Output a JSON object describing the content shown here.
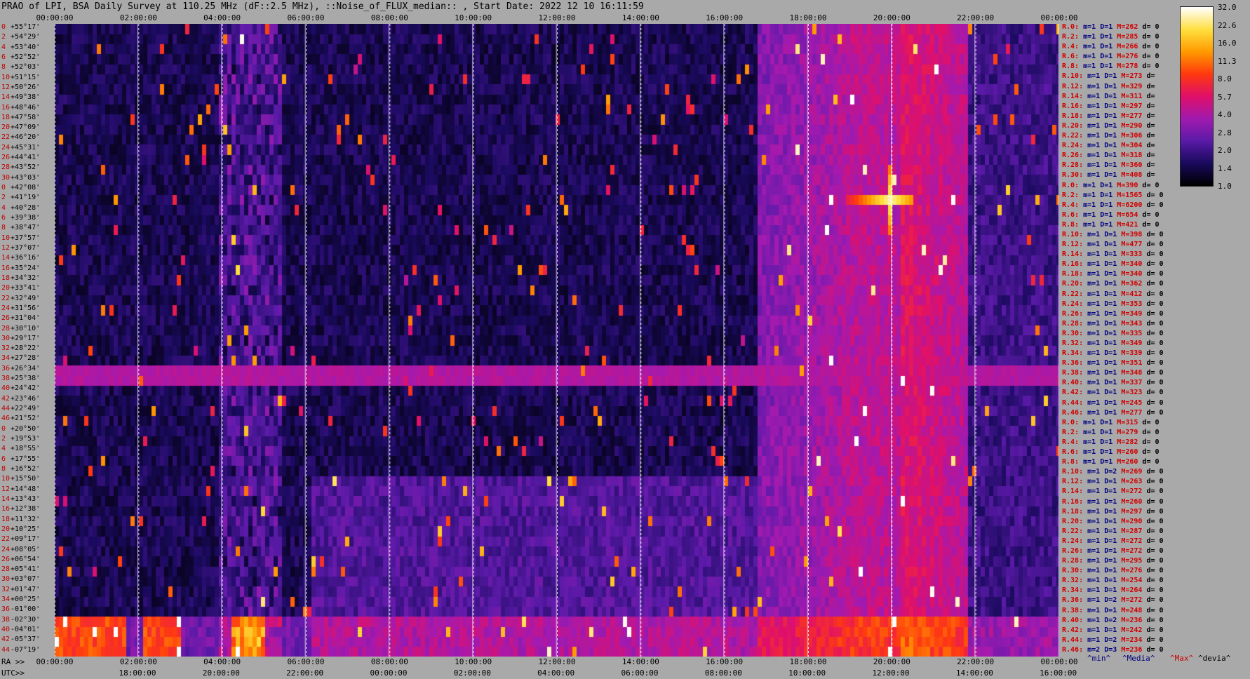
{
  "title": "PRAO of LPI, BSA Daily Survey at 110.25 MHz (dF::2.5 MHz), ::Noise_of_FLUX_median:: , Start Date: 2022 12 10 16:11:59",
  "chart_data": {
    "type": "heatmap",
    "top_axis_ticks": [
      "00:00:00",
      "02:00:00",
      "04:00:00",
      "06:00:00",
      "08:00:00",
      "10:00:00",
      "12:00:00",
      "14:00:00",
      "16:00:00",
      "18:00:00",
      "20:00:00",
      "22:00:00",
      "00:00:00"
    ],
    "ra_axis_label": "RA >>",
    "ra_axis_ticks": [
      "00:00:00",
      "02:00:00",
      "04:00:00",
      "06:00:00",
      "08:00:00",
      "10:00:00",
      "12:00:00",
      "14:00:00",
      "16:00:00",
      "18:00:00",
      "20:00:00",
      "22:00:00",
      "00:00:00"
    ],
    "utc_axis_label": "UTC>>",
    "utc_axis_ticks": [
      "18:00:00",
      "20:00:00",
      "22:00:00",
      "00:00:00",
      "02:00:00",
      "04:00:00",
      "06:00:00",
      "08:00:00",
      "10:00:00",
      "12:00:00",
      "14:00:00",
      "16:00:00"
    ],
    "declinations": [
      "+55°17'",
      "+54°29'",
      "+53°40'",
      "+52°52'",
      "+52°03'",
      "+51°15'",
      "+50°26'",
      "+49°38'",
      "+48°46'",
      "+47°58'",
      "+47°09'",
      "+46°20'",
      "+45°31'",
      "+44°41'",
      "+43°52'",
      "+43°03'",
      "+42°08'",
      "+41°19'",
      "+40°28'",
      "+39°38'",
      "+38°47'",
      "+37°57'",
      "+37°07'",
      "+36°16'",
      "+35°24'",
      "+34°32'",
      "+33°41'",
      "+32°49'",
      "+31°56'",
      "+31°04'",
      "+30°10'",
      "+29°17'",
      "+28°22'",
      "+27°28'",
      "+26°34'",
      "+25°38'",
      "+24°42'",
      "+23°46'",
      "+22°49'",
      "+21°52'",
      "+20°50'",
      "+19°53'",
      "+18°55'",
      "+17°55'",
      "+16°52'",
      "+15°50'",
      "+14°48'",
      "+13°43'",
      "+12°38'",
      "+11°32'",
      "+10°25'",
      "+09°17'",
      "+08°05'",
      "+06°54'",
      "+05°41'",
      "+03°07'",
      "+01°47'",
      "+00°25'",
      "-01°00'",
      "-02°30'",
      "-04°01'",
      "-05°37'",
      "-07°19'"
    ],
    "row_indices": [
      "0",
      "2",
      "4",
      "6",
      "8",
      "10",
      "12",
      "14",
      "16",
      "18",
      "20",
      "22",
      "24",
      "26",
      "28",
      "30",
      "0",
      "2",
      "4",
      "6",
      "8",
      "10",
      "12",
      "14",
      "16",
      "18",
      "20",
      "22",
      "24",
      "26",
      "28",
      "30",
      "32",
      "34",
      "36",
      "38",
      "40",
      "42",
      "44",
      "46",
      "0",
      "2",
      "4",
      "6",
      "8",
      "10",
      "12",
      "14",
      "16",
      "18",
      "20",
      "22",
      "24",
      "26",
      "28",
      "30",
      "32",
      "34",
      "36",
      "38",
      "40",
      "42",
      "44"
    ],
    "beam_stats": [
      {
        "r": "R.0:",
        "m": "m=1",
        "d": "D=1",
        "mx": "M=262",
        "dv": "d= 0"
      },
      {
        "r": "R.2:",
        "m": "m=1",
        "d": "D=1",
        "mx": "M=285",
        "dv": "d= 0"
      },
      {
        "r": "R.4:",
        "m": "m=1",
        "d": "D=1",
        "mx": "M=266",
        "dv": "d= 0"
      },
      {
        "r": "R.6:",
        "m": "m=1",
        "d": "D=1",
        "mx": "M=276",
        "dv": "d= 0"
      },
      {
        "r": "R.8:",
        "m": "m=1",
        "d": "D=1",
        "mx": "M=278",
        "dv": "d= 0"
      },
      {
        "r": "R.10:",
        "m": "m=1",
        "d": "D=1",
        "mx": "M=273",
        "dv": "d="
      },
      {
        "r": "R.12:",
        "m": "m=1",
        "d": "D=1",
        "mx": "M=329",
        "dv": "d="
      },
      {
        "r": "R.14:",
        "m": "m=1",
        "d": "D=1",
        "mx": "M=311",
        "dv": "d="
      },
      {
        "r": "R.16:",
        "m": "m=1",
        "d": "D=1",
        "mx": "M=297",
        "dv": "d="
      },
      {
        "r": "R.18:",
        "m": "m=1",
        "d": "D=1",
        "mx": "M=277",
        "dv": "d="
      },
      {
        "r": "R.20:",
        "m": "m=1",
        "d": "D=1",
        "mx": "M=290",
        "dv": "d="
      },
      {
        "r": "R.22:",
        "m": "m=1",
        "d": "D=1",
        "mx": "M=306",
        "dv": "d="
      },
      {
        "r": "R.24:",
        "m": "m=1",
        "d": "D=1",
        "mx": "M=304",
        "dv": "d="
      },
      {
        "r": "R.26:",
        "m": "m=1",
        "d": "D=1",
        "mx": "M=318",
        "dv": "d="
      },
      {
        "r": "R.28:",
        "m": "m=1",
        "d": "D=1",
        "mx": "M=360",
        "dv": "d="
      },
      {
        "r": "R.30:",
        "m": "m=1",
        "d": "D=1",
        "mx": "M=408",
        "dv": "d="
      },
      {
        "r": "R.0:",
        "m": "m=1",
        "d": "D=1",
        "mx": "M=390",
        "dv": "d= 0"
      },
      {
        "r": "R.2:",
        "m": "m=1",
        "d": "D=1",
        "mx": "M=1565",
        "dv": "d= 0"
      },
      {
        "r": "R.4:",
        "m": "m=1",
        "d": "D=1",
        "mx": "M=6200",
        "dv": "d= 0"
      },
      {
        "r": "R.6:",
        "m": "m=1",
        "d": "D=1",
        "mx": "M=654",
        "dv": "d= 0"
      },
      {
        "r": "R.8:",
        "m": "m=1",
        "d": "D=1",
        "mx": "M=421",
        "dv": "d= 0"
      },
      {
        "r": "R.10:",
        "m": "m=1",
        "d": "D=1",
        "mx": "M=398",
        "dv": "d= 0"
      },
      {
        "r": "R.12:",
        "m": "m=1",
        "d": "D=1",
        "mx": "M=477",
        "dv": "d= 0"
      },
      {
        "r": "R.14:",
        "m": "m=1",
        "d": "D=1",
        "mx": "M=333",
        "dv": "d= 0"
      },
      {
        "r": "R.16:",
        "m": "m=1",
        "d": "D=1",
        "mx": "M=340",
        "dv": "d= 0"
      },
      {
        "r": "R.18:",
        "m": "m=1",
        "d": "D=1",
        "mx": "M=340",
        "dv": "d= 0"
      },
      {
        "r": "R.20:",
        "m": "m=1",
        "d": "D=1",
        "mx": "M=362",
        "dv": "d= 0"
      },
      {
        "r": "R.22:",
        "m": "m=1",
        "d": "D=1",
        "mx": "M=412",
        "dv": "d= 0"
      },
      {
        "r": "R.24:",
        "m": "m=1",
        "d": "D=1",
        "mx": "M=353",
        "dv": "d= 0"
      },
      {
        "r": "R.26:",
        "m": "m=1",
        "d": "D=1",
        "mx": "M=349",
        "dv": "d= 0"
      },
      {
        "r": "R.28:",
        "m": "m=1",
        "d": "D=1",
        "mx": "M=343",
        "dv": "d= 0"
      },
      {
        "r": "R.30:",
        "m": "m=1",
        "d": "D=1",
        "mx": "M=335",
        "dv": "d= 0"
      },
      {
        "r": "R.32:",
        "m": "m=1",
        "d": "D=1",
        "mx": "M=349",
        "dv": "d= 0"
      },
      {
        "r": "R.34:",
        "m": "m=1",
        "d": "D=1",
        "mx": "M=339",
        "dv": "d= 0"
      },
      {
        "r": "R.36:",
        "m": "m=1",
        "d": "D=1",
        "mx": "M=351",
        "dv": "d= 0"
      },
      {
        "r": "R.38:",
        "m": "m=1",
        "d": "D=1",
        "mx": "M=348",
        "dv": "d= 0"
      },
      {
        "r": "R.40:",
        "m": "m=1",
        "d": "D=1",
        "mx": "M=337",
        "dv": "d= 0"
      },
      {
        "r": "R.42:",
        "m": "m=1",
        "d": "D=1",
        "mx": "M=323",
        "dv": "d= 0"
      },
      {
        "r": "R.44:",
        "m": "m=1",
        "d": "D=1",
        "mx": "M=245",
        "dv": "d= 0"
      },
      {
        "r": "R.46:",
        "m": "m=1",
        "d": "D=1",
        "mx": "M=277",
        "dv": "d= 0"
      },
      {
        "r": "R.0:",
        "m": "m=1",
        "d": "D=1",
        "mx": "M=315",
        "dv": "d= 0"
      },
      {
        "r": "R.2:",
        "m": "m=1",
        "d": "D=1",
        "mx": "M=279",
        "dv": "d= 0"
      },
      {
        "r": "R.4:",
        "m": "m=1",
        "d": "D=1",
        "mx": "M=282",
        "dv": "d= 0"
      },
      {
        "r": "R.6:",
        "m": "m=1",
        "d": "D=1",
        "mx": "M=260",
        "dv": "d= 0"
      },
      {
        "r": "R.8:",
        "m": "m=1",
        "d": "D=1",
        "mx": "M=260",
        "dv": "d= 0"
      },
      {
        "r": "R.10:",
        "m": "m=1",
        "d": "D=2",
        "mx": "M=269",
        "dv": "d= 0"
      },
      {
        "r": "R.12:",
        "m": "m=1",
        "d": "D=1",
        "mx": "M=263",
        "dv": "d= 0"
      },
      {
        "r": "R.14:",
        "m": "m=1",
        "d": "D=1",
        "mx": "M=272",
        "dv": "d= 0"
      },
      {
        "r": "R.16:",
        "m": "m=1",
        "d": "D=1",
        "mx": "M=260",
        "dv": "d= 0"
      },
      {
        "r": "R.18:",
        "m": "m=1",
        "d": "D=1",
        "mx": "M=297",
        "dv": "d= 0"
      },
      {
        "r": "R.20:",
        "m": "m=1",
        "d": "D=1",
        "mx": "M=290",
        "dv": "d= 0"
      },
      {
        "r": "R.22:",
        "m": "m=1",
        "d": "D=1",
        "mx": "M=287",
        "dv": "d= 0"
      },
      {
        "r": "R.24:",
        "m": "m=1",
        "d": "D=1",
        "mx": "M=272",
        "dv": "d= 0"
      },
      {
        "r": "R.26:",
        "m": "m=1",
        "d": "D=1",
        "mx": "M=272",
        "dv": "d= 0"
      },
      {
        "r": "R.28:",
        "m": "m=1",
        "d": "D=1",
        "mx": "M=295",
        "dv": "d= 0"
      },
      {
        "r": "R.30:",
        "m": "m=1",
        "d": "D=1",
        "mx": "M=276",
        "dv": "d= 0"
      },
      {
        "r": "R.32:",
        "m": "m=1",
        "d": "D=1",
        "mx": "M=254",
        "dv": "d= 0"
      },
      {
        "r": "R.34:",
        "m": "m=1",
        "d": "D=1",
        "mx": "M=264",
        "dv": "d= 0"
      },
      {
        "r": "R.36:",
        "m": "m=1",
        "d": "D=2",
        "mx": "M=272",
        "dv": "d= 0"
      },
      {
        "r": "R.38:",
        "m": "m=1",
        "d": "D=1",
        "mx": "M=248",
        "dv": "d= 0"
      },
      {
        "r": "R.40:",
        "m": "m=1",
        "d": "D=2",
        "mx": "M=236",
        "dv": "d= 0"
      },
      {
        "r": "R.42:",
        "m": "m=1",
        "d": "D=1",
        "mx": "M=242",
        "dv": "d= 0"
      },
      {
        "r": "R.44:",
        "m": "m=1",
        "d": "D=2",
        "mx": "M=234",
        "dv": "d= 0"
      },
      {
        "r": "R.46:",
        "m": "m=2",
        "d": "D=3",
        "mx": "M=236",
        "dv": "d= 0"
      }
    ],
    "colorbar_ticks": [
      "32.0",
      "22.6",
      "16.0",
      "11.3",
      "8.0",
      "5.7",
      "4.0",
      "2.8",
      "2.0",
      "1.4",
      "1.0"
    ],
    "colorbar_range": [
      1.0,
      32.0
    ],
    "colorbar_scale": "log2",
    "colorbar_colors": [
      "#000000",
      "#1a0a5e",
      "#5b1aa8",
      "#a21ab0",
      "#e0106a",
      "#ff3a10",
      "#ff9a00",
      "#ffe040",
      "#ffffff"
    ],
    "legend": [
      "^min^",
      "^Media^",
      "^Max^",
      "^devia^"
    ],
    "legend_colors": [
      "#000080",
      "#000080",
      "#d00000",
      "#000000"
    ],
    "strong_source_ra_hours": 19.9,
    "strong_source_dec": "+41°19'"
  }
}
